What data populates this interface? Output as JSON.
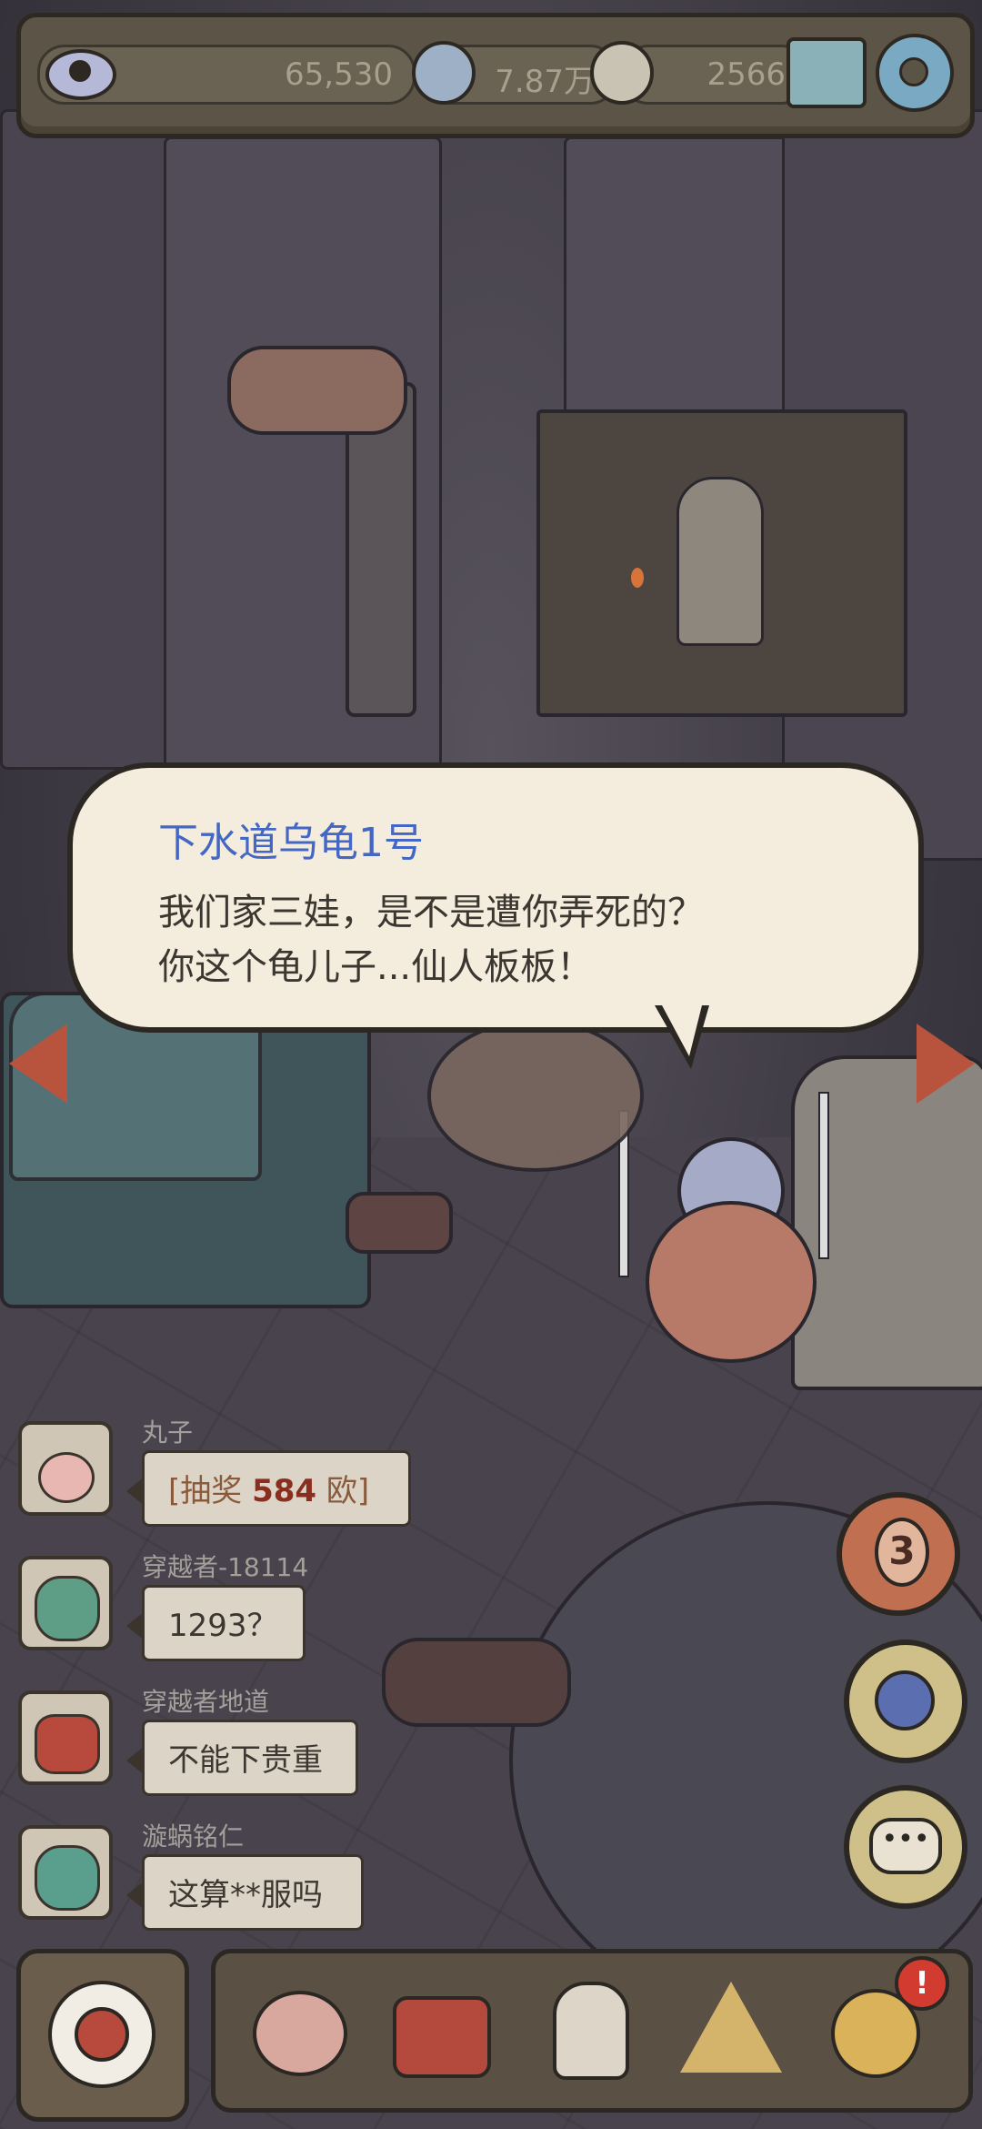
{
  "topbar": {
    "views": "65,530",
    "likes": "7.87万",
    "comments": "2566",
    "icons": [
      "eye-icon",
      "speech-like-icon",
      "speech-comment-icon",
      "mail-icon",
      "gear-icon"
    ]
  },
  "dialogue": {
    "speaker": "下水道乌龟1号",
    "line1": "我们家三娃，是不是遭你弄死的？",
    "line2": "你这个龟儿子...仙人板板！"
  },
  "chat": [
    {
      "user": "丸子",
      "msg_prefix": "[抽奖 ",
      "msg_number": "584",
      "msg_suffix": " 欧]"
    },
    {
      "user": "穿越者-18114",
      "msg": "1293？"
    },
    {
      "user": "穿越者地道",
      "msg": "不能下贵重"
    },
    {
      "user": "漩蜗铭仁",
      "msg": "这算**服吗"
    }
  ],
  "right_buttons": {
    "badge_count": "3"
  },
  "bottom": {
    "items": [
      "snail-icon",
      "backpack-icon",
      "statue-icon",
      "pyramid-eye-icon",
      "magnifier-icon"
    ],
    "alert": "!"
  },
  "colors": {
    "speaker": "#4466c4",
    "bubble": "#f4ecdc",
    "arrow": "#b8543e"
  }
}
